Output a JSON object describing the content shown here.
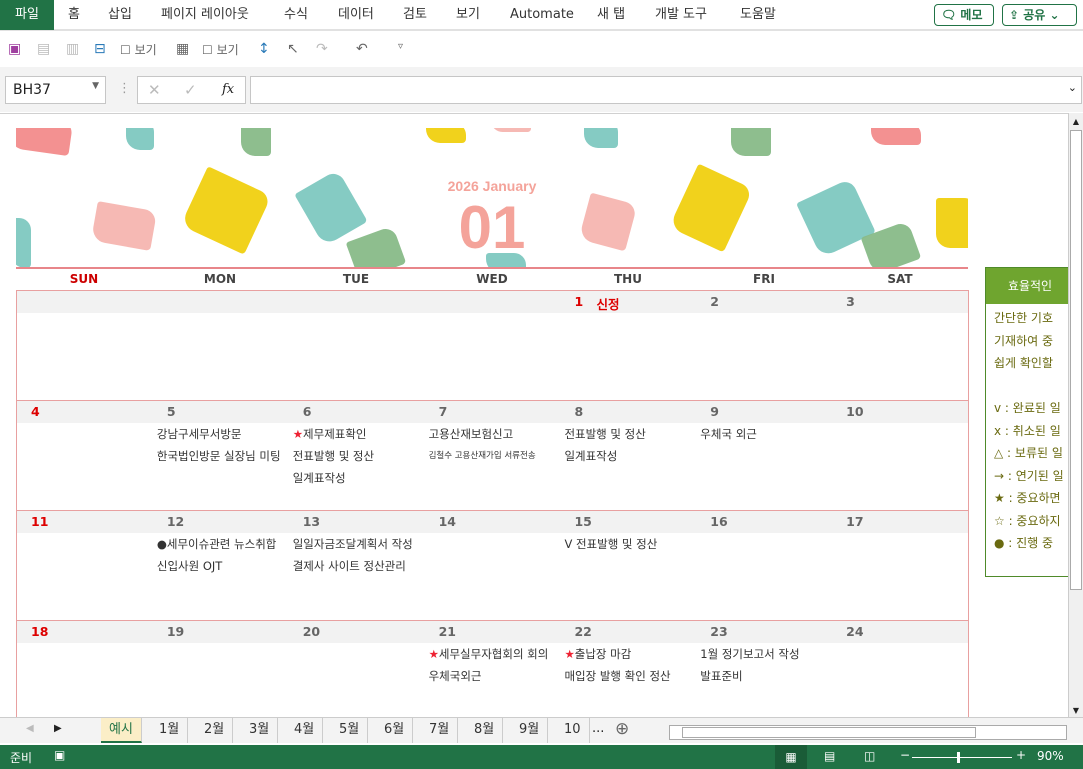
{
  "ribbon": {
    "tabs": [
      "파일",
      "홈",
      "삽입",
      "페이지 레이아웃",
      "수식",
      "데이터",
      "검토",
      "보기",
      "Automate",
      "새 탭",
      "개발 도구",
      "도움말"
    ],
    "memo": "메모",
    "share": "공유"
  },
  "qat": {
    "view1": "보기",
    "view2": "보기"
  },
  "formula": {
    "namebox": "BH37",
    "fx": "fx",
    "value": ""
  },
  "calendar": {
    "year_month": "2026 January",
    "month_num": "01",
    "days": [
      "SUN",
      "MON",
      "TUE",
      "WED",
      "THU",
      "FRI",
      "SAT"
    ],
    "weeks": [
      [
        {
          "d": ""
        },
        {
          "d": ""
        },
        {
          "d": ""
        },
        {
          "d": ""
        },
        {
          "d": "1",
          "hol": "신정",
          "red": true
        },
        {
          "d": "2"
        },
        {
          "d": "3"
        }
      ],
      [
        {
          "d": "4",
          "red": true
        },
        {
          "d": "5",
          "ev": [
            {
              "t": "강남구세무서방문"
            },
            {
              "t": "한국법인방문 실장님 미팅"
            }
          ]
        },
        {
          "d": "6",
          "ev": [
            {
              "m": "★",
              "t": "제무제표확인"
            },
            {
              "t": "전표발행 및 정산"
            },
            {
              "t": "일계표작성"
            }
          ]
        },
        {
          "d": "7",
          "ev": [
            {
              "t": "고용산재보험신고"
            },
            {
              "t": "김철수 고용산재가입 서류전송",
              "small": true
            }
          ]
        },
        {
          "d": "8",
          "ev": [
            {
              "t": "전표발행 및 정산"
            },
            {
              "t": "일계표작성"
            }
          ]
        },
        {
          "d": "9",
          "ev": [
            {
              "t": "우체국 외근"
            }
          ]
        },
        {
          "d": "10"
        }
      ],
      [
        {
          "d": "11",
          "red": true
        },
        {
          "d": "12",
          "ev": [
            {
              "t": "●세무이슈관련 뉴스취합"
            },
            {
              "t": "신입사원 OJT"
            }
          ]
        },
        {
          "d": "13",
          "ev": [
            {
              "t": "일일자금조달계획서 작성"
            },
            {
              "t": "결제사 사이트 정산관리"
            }
          ]
        },
        {
          "d": "14"
        },
        {
          "d": "15",
          "ev": [
            {
              "t": "V 전표발행 및 정산"
            }
          ]
        },
        {
          "d": "16"
        },
        {
          "d": "17"
        }
      ],
      [
        {
          "d": "18",
          "red": true
        },
        {
          "d": "19"
        },
        {
          "d": "20"
        },
        {
          "d": "21",
          "ev": [
            {
              "m": "★",
              "t": "세무실무자협회의 회의"
            },
            {
              "t": "우체국외근"
            }
          ]
        },
        {
          "d": "22",
          "ev": [
            {
              "m": "★",
              "t": "출납장 마감"
            },
            {
              "t": "매입장 발행 확인 정산"
            }
          ]
        },
        {
          "d": "23",
          "ev": [
            {
              "t": "1월 정기보고서 작성"
            },
            {
              "t": "발표준비"
            }
          ]
        },
        {
          "d": "24"
        }
      ]
    ]
  },
  "legend": {
    "title": "효율적인",
    "lines": [
      "간단한 기호",
      "기재하여 중",
      "쉽게 확인할",
      "",
      "v : 완료된 일",
      "x : 취소된 일",
      "△ : 보류된 일",
      "→ : 연기된 일",
      "★ : 중요하면",
      "☆ : 중요하지",
      "● : 진행 중"
    ]
  },
  "sheets": {
    "tabs": [
      "예시",
      "1월",
      "2월",
      "3월",
      "4월",
      "5월",
      "6월",
      "7월",
      "8월",
      "9월",
      "10"
    ],
    "more": "...",
    "active": "예시"
  },
  "status": {
    "ready": "준비",
    "zoom": "90%"
  }
}
